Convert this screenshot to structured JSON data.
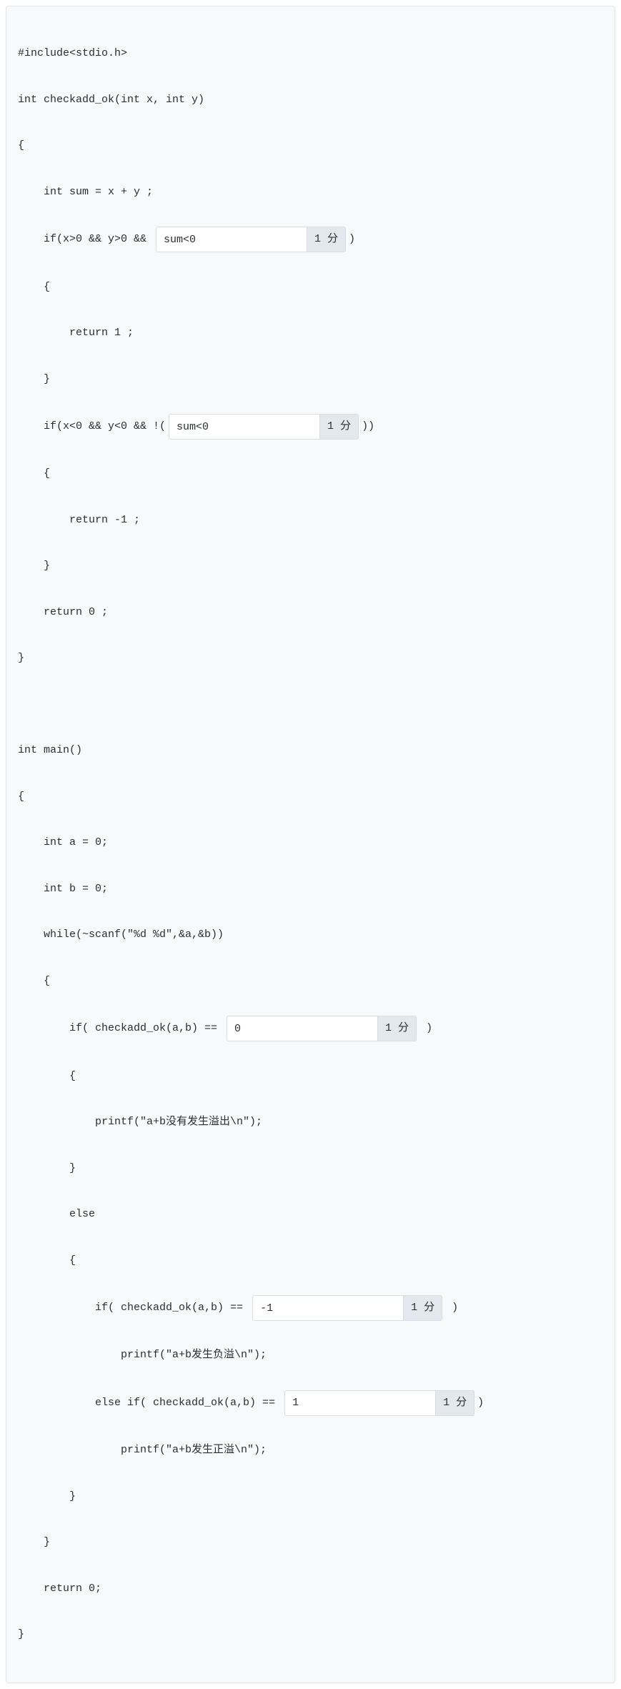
{
  "code": {
    "line1": "#include<stdio.h>",
    "line2": "int checkadd_ok(int x, int y)",
    "line3": "{",
    "line4": "    int sum = x + y ;",
    "line5_pre": "    if(x>0 && y>0 && ",
    "line5_post": ")",
    "line6": "    {",
    "line7": "        return 1 ;",
    "line8": "    }",
    "line9_pre": "    if(x<0 && y<0 && !(",
    "line9_post": "))",
    "line10": "    {",
    "line11": "        return -1 ;",
    "line12": "    }",
    "line13": "    return 0 ;",
    "line14": "}",
    "line15": "",
    "line16": "",
    "line17": "int main()",
    "line18": "{",
    "line19": "    int a = 0;",
    "line20": "    int b = 0;",
    "line21": "    while(~scanf(\"%d %d\",&a,&b))",
    "line22": "    {",
    "line23_pre": "        if( checkadd_ok(a,b) == ",
    "line23_post": " )",
    "line24": "        {",
    "line25": "            printf(\"a+b没有发生溢出\\n\");",
    "line26": "        }",
    "line27": "        else",
    "line28": "        {",
    "line29_pre": "            if( checkadd_ok(a,b) == ",
    "line29_post": " )",
    "line30": "                printf(\"a+b发生负溢\\n\");",
    "line31_pre": "            else if( checkadd_ok(a,b) == ",
    "line31_post": ")",
    "line32": "                printf(\"a+b发生正溢\\n\");",
    "line33": "        }",
    "line34": "    }",
    "line35": "    return 0;",
    "line36": "}"
  },
  "blanks": {
    "b1": {
      "value": "sum<0",
      "score": "1 分"
    },
    "b2": {
      "value": "sum<0",
      "score": "1 分"
    },
    "b3": {
      "value": "0",
      "score": "1 分"
    },
    "b4": {
      "value": "-1",
      "score": "1 分"
    },
    "b5": {
      "value": "1",
      "score": "1 分"
    }
  }
}
